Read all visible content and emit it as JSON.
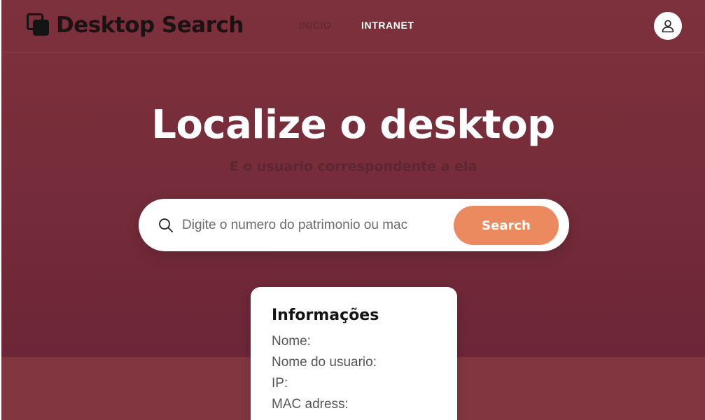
{
  "brand": {
    "name": "Desktop Search"
  },
  "nav": {
    "items": [
      {
        "label": "INICIO"
      },
      {
        "label": "INTRANET"
      }
    ]
  },
  "hero": {
    "title": "Localize o desktop",
    "subtitle": "E o usuario correspondente a ela"
  },
  "search": {
    "placeholder": "Digite o numero do patrimonio ou mac",
    "button_label": "Search"
  },
  "info": {
    "title": "Informações",
    "fields": [
      {
        "label": "Nome:"
      },
      {
        "label": "Nome do usuario:"
      },
      {
        "label": "IP:"
      },
      {
        "label": "MAC adress:"
      }
    ]
  },
  "colors": {
    "hero_bg": "#7a2e3a",
    "accent_button": "#eb8a5e",
    "subtitle": "#5e2632"
  },
  "icons": {
    "logo": "stacked-squares-icon",
    "user": "user-icon",
    "search": "search-icon"
  }
}
